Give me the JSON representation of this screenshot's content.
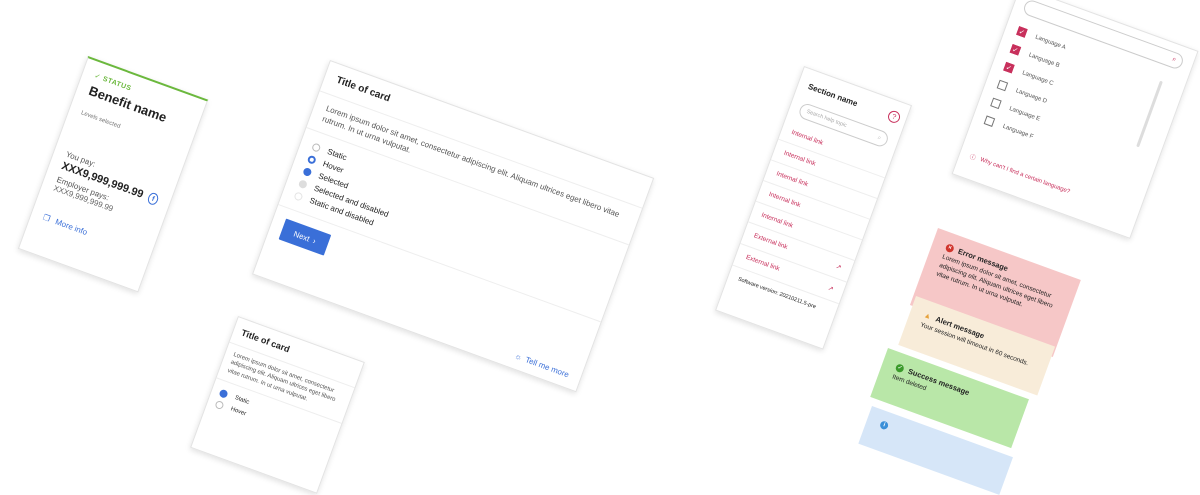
{
  "benefit_card": {
    "status": "STATUS",
    "name": "Benefit name",
    "levels": "Levels selected",
    "you_pay_label": "You pay:",
    "you_pay_value": "XXX9,999,999.99",
    "employer_label": "Employer pays:",
    "employer_value": "XXX9,999,999.99",
    "more_info": "More info"
  },
  "big_card": {
    "title": "Title of card",
    "body": "Lorem ipsum dolor sit amet, consectetur adipiscing elit. Aliquam ultrices eget libero vitae rutrum. In ut urna vulputat.",
    "options": [
      "Static",
      "Hover",
      "Selected",
      "Selected and disabled",
      "Static and disabled"
    ],
    "next_label": "Next",
    "tell_me_more": "Tell me more"
  },
  "small_card": {
    "title": "Title of card",
    "body": "Lorem ipsum dolor sit amet, consectetur adipiscing elit. Aliquam ultrices eget libero vitae rutrum. In ut urna vulputat.",
    "options": [
      "Static",
      "Hover"
    ]
  },
  "nav_panel": {
    "title": "Section name",
    "search_placeholder": "Search help topic",
    "items": [
      {
        "label": "Internal link",
        "external": false
      },
      {
        "label": "Internal link",
        "external": false
      },
      {
        "label": "Internal link",
        "external": false
      },
      {
        "label": "Internal link",
        "external": false
      },
      {
        "label": "Internal link",
        "external": false
      },
      {
        "label": "External link",
        "external": true
      },
      {
        "label": "External link",
        "external": true
      }
    ],
    "version": "Software version: 20210211.5-pre"
  },
  "language_list": {
    "items": [
      {
        "label": "Language A",
        "checked": true
      },
      {
        "label": "Language B",
        "checked": true
      },
      {
        "label": "Language C",
        "checked": true
      },
      {
        "label": "Language D",
        "checked": false
      },
      {
        "label": "Language E",
        "checked": false
      },
      {
        "label": "Language F",
        "checked": false
      }
    ],
    "why_link": "Why can't I find a certain language?"
  },
  "messages": {
    "error_title": "Error message",
    "error_text": "Lorem ipsum dolor sit amet, consectetur adipiscing elit. Aliquam ultrices eget libero vitae rutrum. In ut urna vulputat.",
    "alert_title": "Alert message",
    "alert_text": "Your session will timeout in 60 seconds.",
    "success_title": "Success message",
    "success_text": "Item deleted"
  },
  "colors": {
    "accent_blue": "#3a6fd8",
    "link_pink": "#c8305c",
    "status_green": "#6bb83d",
    "error_bg": "#f6c7c7",
    "alert_bg": "#f8ecd9",
    "success_bg": "#b9e7a8"
  }
}
